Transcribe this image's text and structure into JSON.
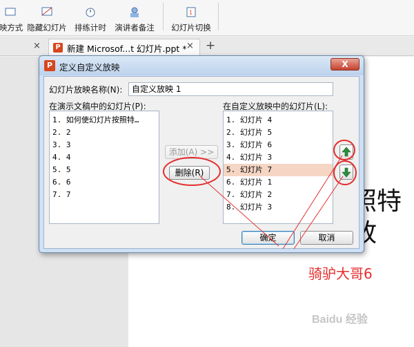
{
  "toolbar": {
    "buttons": [
      {
        "label": "映方式",
        "icon": "slide-show-setup-icon"
      },
      {
        "label": "隐藏幻灯片",
        "icon": "hide-slide-icon"
      },
      {
        "label": "排练计时",
        "icon": "rehearse-timing-icon"
      },
      {
        "label": "演讲者备注",
        "icon": "speaker-notes-icon"
      },
      {
        "label": "幻灯片切换",
        "icon": "slide-transition-icon"
      }
    ]
  },
  "tabs": {
    "active_tab_label": "新建 Microsof...t 幻灯片.ppt *",
    "close_glyph": "×",
    "new_tab_glyph": "+"
  },
  "slide": {
    "line1": "照特",
    "line2": "放"
  },
  "dialog": {
    "title": "定义自定义放映",
    "logo_glyph": "P",
    "close_glyph": "X",
    "name_label": "幻灯片放映名称(N):",
    "name_value": "自定义放映 1",
    "left_list_label": "在演示文稿中的幻灯片(P):",
    "right_list_label": "在自定义放映中的幻灯片(L):",
    "left_list": [
      "1. 如何使幻灯片按照特…",
      "2. 2",
      "3. 3",
      "4. 4",
      "5. 5",
      "6. 6",
      "7. 7"
    ],
    "right_list": [
      "1. 幻灯片 4",
      "2. 幻灯片 5",
      "3. 幻灯片 6",
      "4. 幻灯片 3",
      "5. 幻灯片 7",
      "6. 幻灯片 1",
      "7. 幻灯片 2",
      "8. 幻灯片 3"
    ],
    "selected_right_index": 4,
    "add_button": "添加(A) >>",
    "remove_button": "删除(R)",
    "ok_button": "确定",
    "cancel_button": "取消"
  },
  "annotation": {
    "label": "骑驴大哥6",
    "color": "#e52d2d"
  },
  "watermark": "Baidu 经验"
}
